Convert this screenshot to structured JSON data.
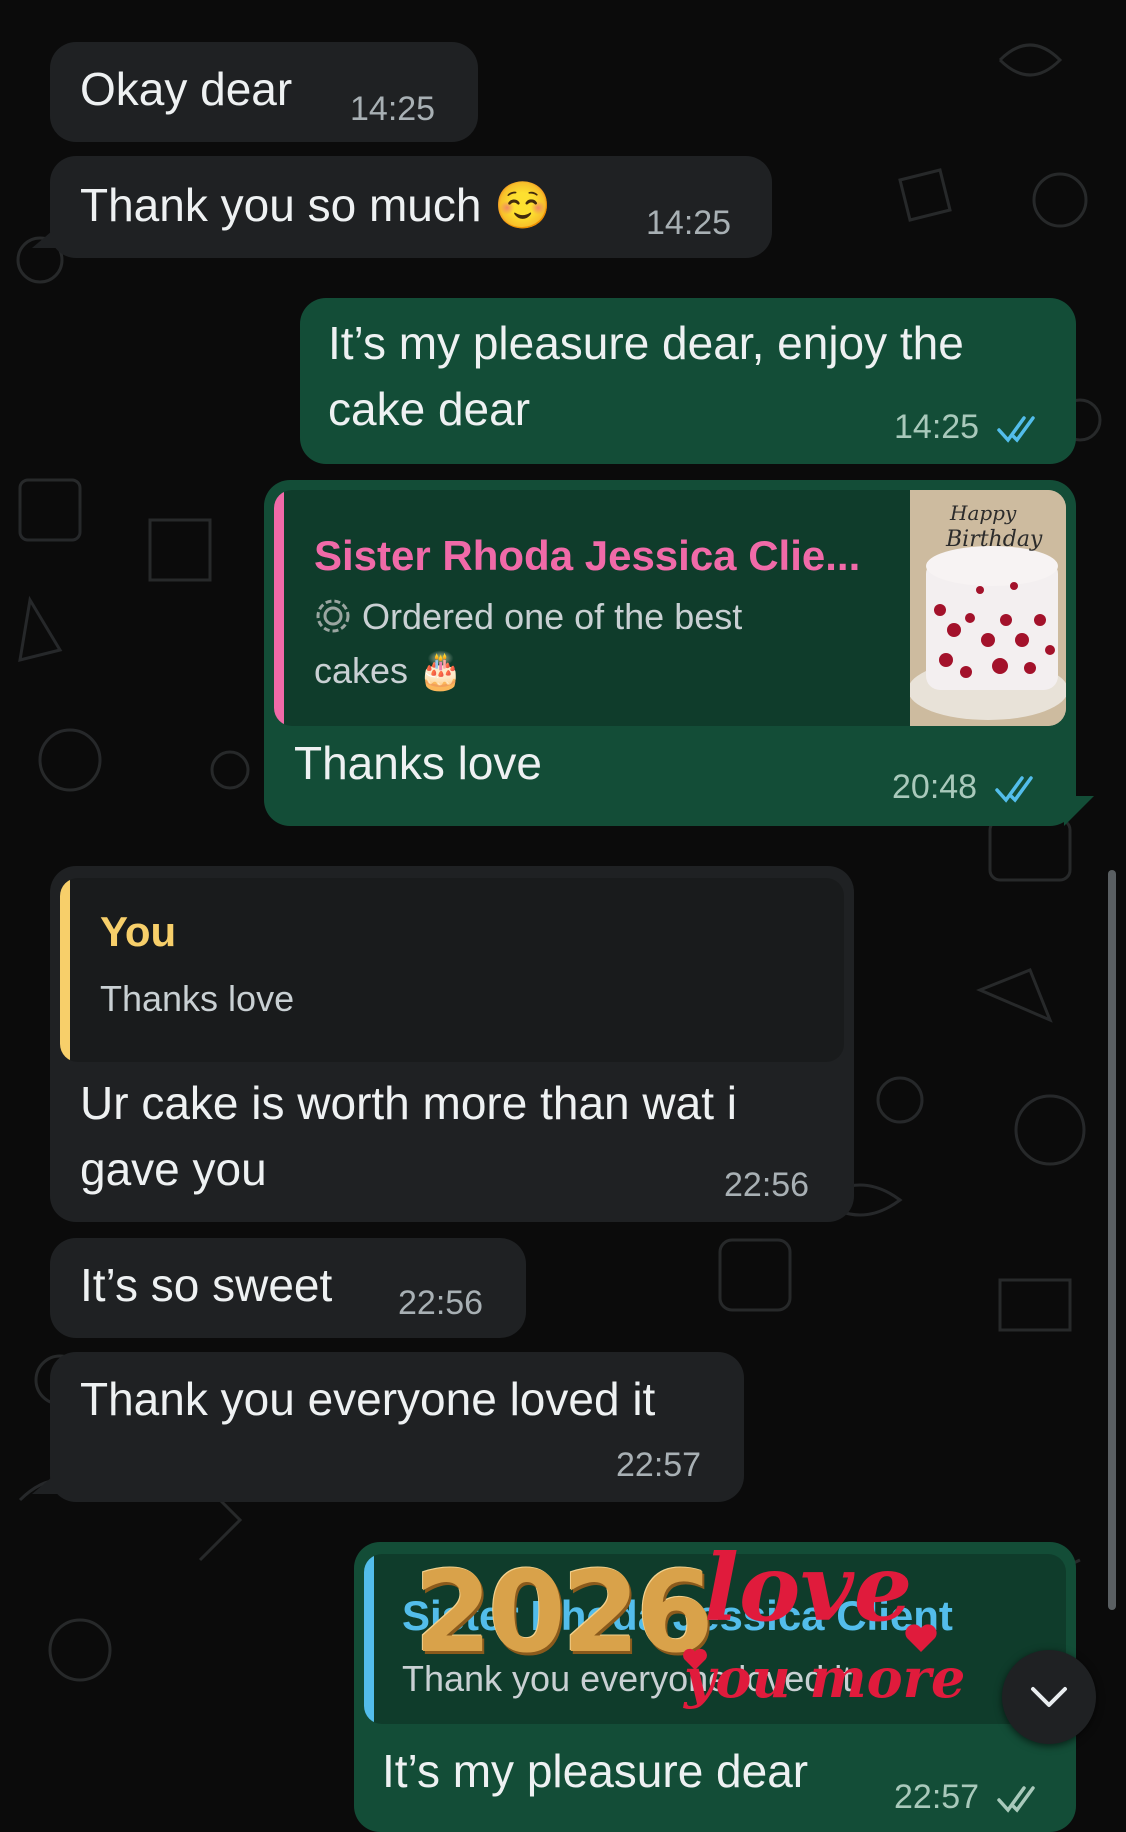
{
  "theme": {
    "incoming_bubble": "#1f2123",
    "outgoing_bubble": "#134d37",
    "quote_name_pink": "#f06aa8",
    "quote_name_yellow": "#f7cf6a",
    "quote_name_blue": "#53bdeb",
    "read_ticks": "#53bdeb"
  },
  "messages": [
    {
      "text": "Okay dear",
      "time": "14:25"
    },
    {
      "text": "Thank you so much ☺️",
      "time": "14:25"
    },
    {
      "text": "It’s my pleasure dear, enjoy the cake dear",
      "time": "14:25",
      "status": "read"
    },
    {
      "quote": {
        "name": "Sister Rhoda Jessica Clie...",
        "icon": "status-ring-icon",
        "text": "Ordered one of the best cakes 🎂",
        "thumbnail": "red velvet birthday cake with Happy Birthday topper"
      },
      "text": "Thanks love",
      "time": "20:48",
      "status": "read"
    },
    {
      "quote": {
        "name": "You",
        "text": "Thanks love"
      },
      "text": "Ur cake is worth more than wat i gave you",
      "time": "22:56"
    },
    {
      "text": "It’s so sweet",
      "time": "22:56"
    },
    {
      "text": "Thank you everyone loved it",
      "time": "22:57"
    },
    {
      "quote": {
        "name": "Sister Rhoda Jessica Client",
        "text": "Thank you everyone loved it"
      },
      "text": "It’s my pleasure dear",
      "time": "22:57",
      "status": "sent"
    }
  ],
  "sticker": {
    "year": "2026",
    "line1": "love",
    "line2": "you more"
  },
  "scroll_button": {
    "icon": "chevron-down-icon"
  }
}
